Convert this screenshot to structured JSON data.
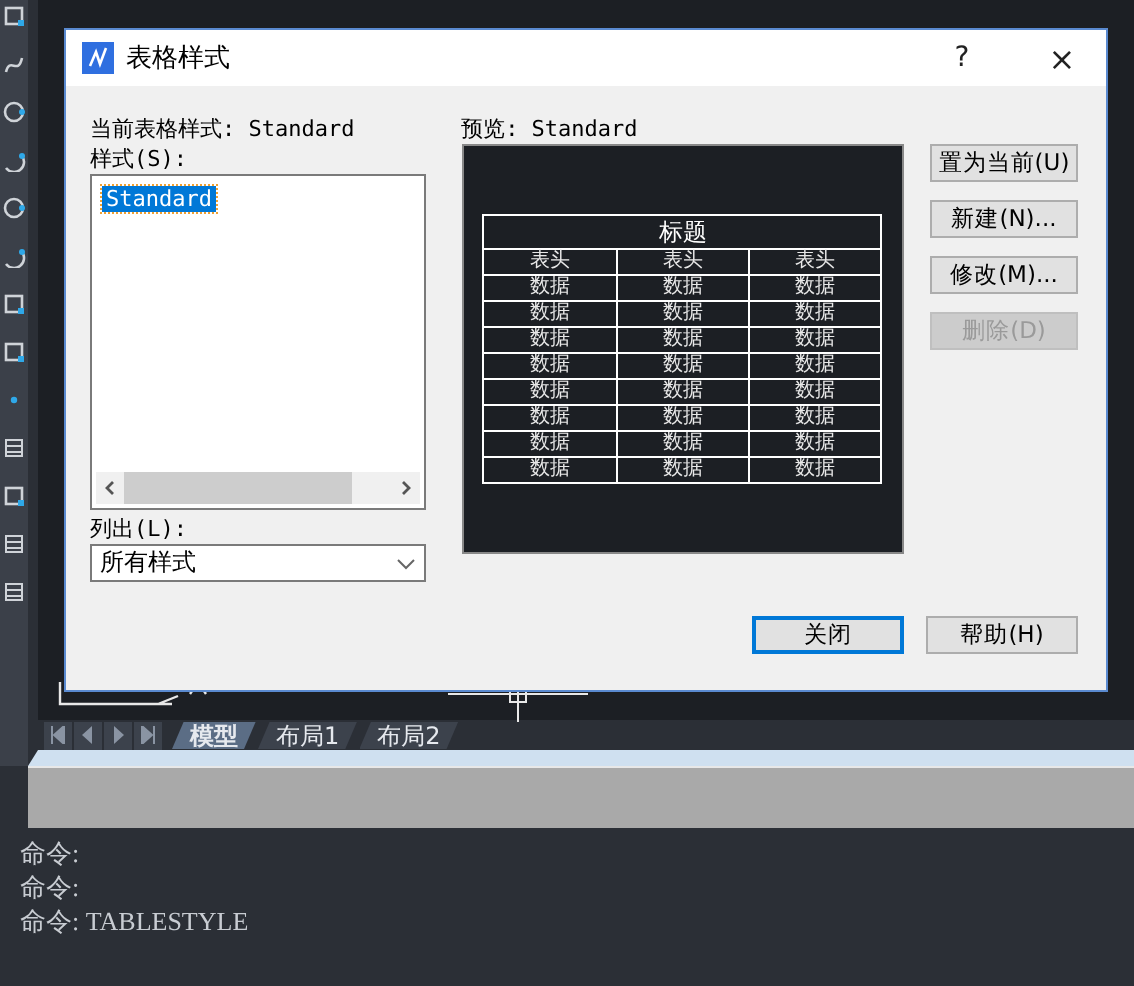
{
  "dialog": {
    "title": "表格样式",
    "help_glyph": "?",
    "close_glyph": "×",
    "current_style_label": "当前表格样式: Standard",
    "styles_label": "样式(S):",
    "styles": [
      {
        "label": "Standard",
        "selected": true
      }
    ],
    "list_label": "列出(L):",
    "list_value": "所有样式",
    "preview_label": "预览: Standard",
    "preview_table": {
      "title": "标题",
      "header": [
        "表头",
        "表头",
        "表头"
      ],
      "rows": [
        [
          "数据",
          "数据",
          "数据"
        ],
        [
          "数据",
          "数据",
          "数据"
        ],
        [
          "数据",
          "数据",
          "数据"
        ],
        [
          "数据",
          "数据",
          "数据"
        ],
        [
          "数据",
          "数据",
          "数据"
        ],
        [
          "数据",
          "数据",
          "数据"
        ],
        [
          "数据",
          "数据",
          "数据"
        ],
        [
          "数据",
          "数据",
          "数据"
        ]
      ]
    },
    "side_buttons": [
      {
        "label": "置为当前(U)",
        "disabled": false
      },
      {
        "label": "新建(N)...",
        "disabled": false
      },
      {
        "label": "修改(M)...",
        "disabled": false
      },
      {
        "label": "删除(D)",
        "disabled": true
      }
    ],
    "footer_buttons": [
      {
        "label": "关闭",
        "default": true
      },
      {
        "label": "帮助(H)",
        "default": false
      }
    ]
  },
  "layout_tabs": [
    {
      "label": "模型",
      "selected": true
    },
    {
      "label": "布局1",
      "selected": false
    },
    {
      "label": "布局2",
      "selected": false
    }
  ],
  "command_lines": [
    "命令:",
    "命令:",
    "命令: TABLESTYLE"
  ]
}
